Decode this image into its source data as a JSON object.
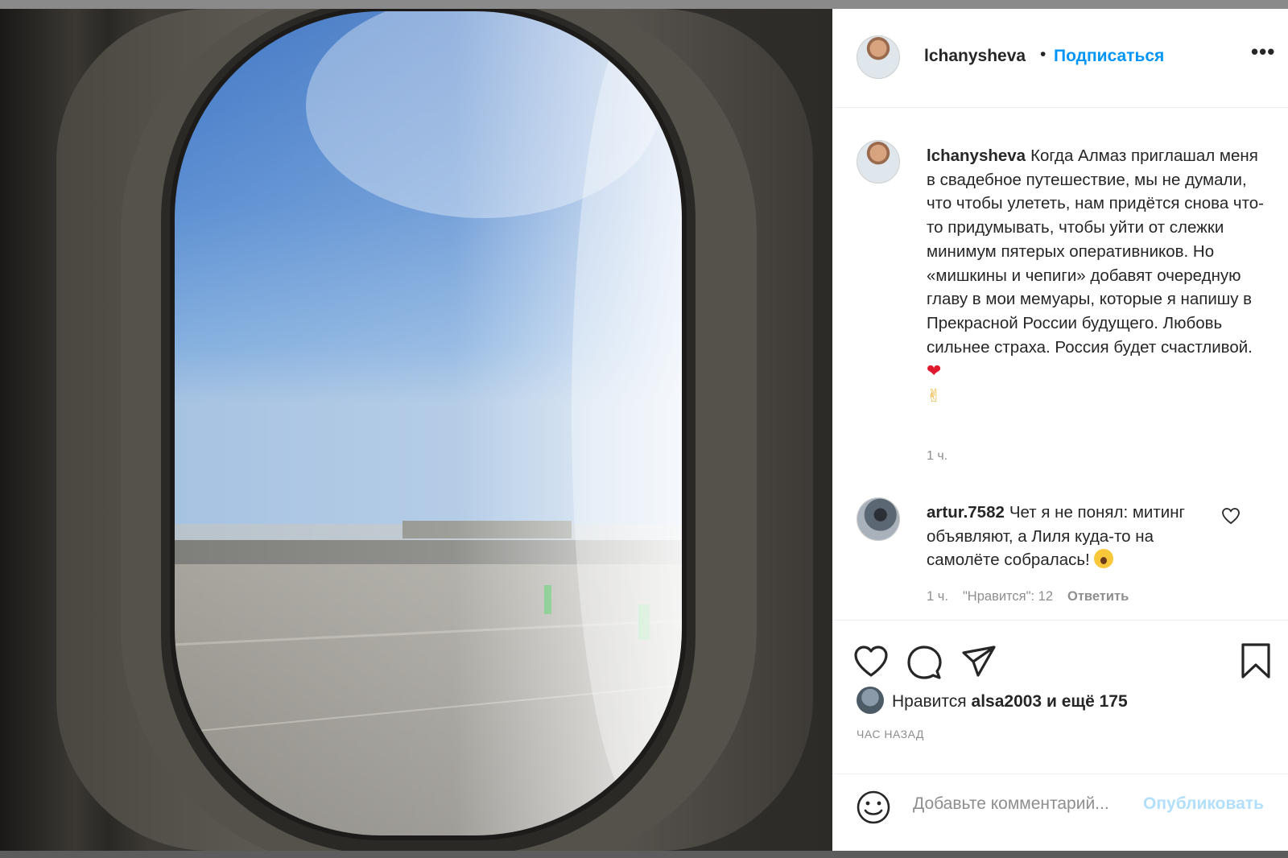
{
  "post": {
    "username": "lchanysheva",
    "separator": "•",
    "follow_label": "Подписаться",
    "more_label": "•••",
    "caption_text": "Когда Алмаз приглашал меня в свадебное путешествие, мы не думали, что чтобы улететь, нам придётся снова что-то придумывать, чтобы уйти от слежки минимум пятерых оперативников. Но «мишкины и чепиги» добавят очередную главу в мои мемуары, которые я напишу в Прекрасной России будущего. Любовь сильнее страха. Россия будет счастливой.",
    "caption_emoji_1": "❤",
    "caption_emoji_2": "✌",
    "caption_time": "1 ч."
  },
  "comment": {
    "username": "artur.7582",
    "text": "Чет я не понял: митинг объявляют, а Лиля куда-то на самолёте собралась!",
    "time": "1 ч.",
    "likes": "\"Нравится\": 12",
    "reply_label": "Ответить"
  },
  "actions": {
    "likes_prefix": "Нравится",
    "liker": "alsa2003",
    "likes_suffix": "и ещё 175",
    "posted_ago": "ЧАС НАЗАД"
  },
  "composer": {
    "placeholder": "Добавьте комментарий...",
    "publish_label": "Опубликовать"
  },
  "colors": {
    "link_blue": "#0095f6",
    "publish_disabled": "#b2dffc",
    "text": "#262626",
    "secondary": "#8e8e8e"
  },
  "icons": [
    "more-icon",
    "heart-icon",
    "comment-icon",
    "share-icon",
    "bookmark-icon",
    "smile-icon",
    "comment-like-icon"
  ]
}
